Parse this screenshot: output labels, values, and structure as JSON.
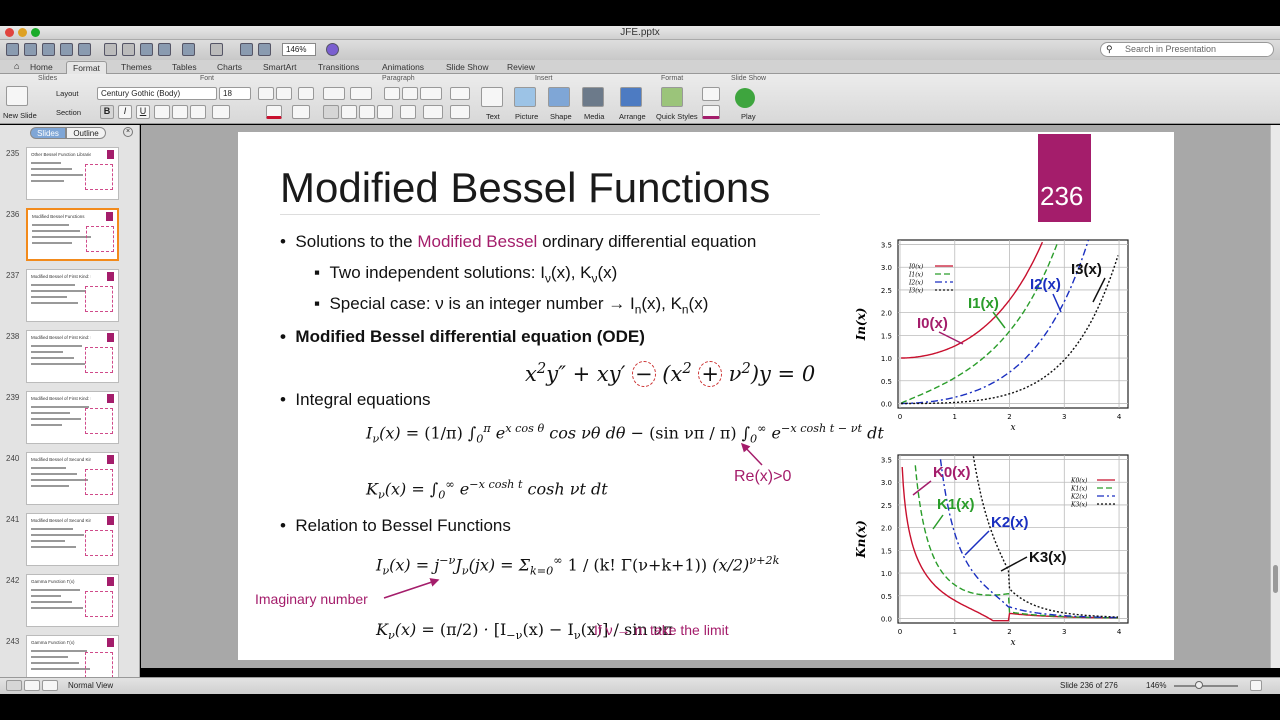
{
  "window": {
    "title": "JFE.pptx"
  },
  "toolbar": {
    "zoom": "146%",
    "search_placeholder": "Search in Presentation"
  },
  "ribbon_tabs": [
    "Home",
    "Format",
    "Themes",
    "Tables",
    "Charts",
    "SmartArt",
    "Transitions",
    "Animations",
    "Slide Show",
    "Review"
  ],
  "ribbon": {
    "groups": {
      "slides": "Slides",
      "font": "Font",
      "paragraph": "Paragraph",
      "insert": "Insert",
      "format": "Format",
      "slideshow": "Slide Show"
    },
    "new_slide": "New Slide",
    "layout": "Layout",
    "section": "Section",
    "font_name": "Century Gothic (Body)",
    "font_size": "18",
    "insert_items": [
      "Text",
      "Picture",
      "Shape",
      "Media"
    ],
    "format_items": [
      "Arrange",
      "Quick Styles"
    ],
    "play": "Play"
  },
  "sidebar": {
    "tabs": [
      "Slides",
      "Outline"
    ],
    "thumbs": [
      {
        "num": "235",
        "title": "Other Bessel Function Libraries"
      },
      {
        "num": "236",
        "title": "Modified Bessel Functions"
      },
      {
        "num": "237",
        "title": "Modified Bessel of First Kind: I_n(x)"
      },
      {
        "num": "238",
        "title": "Modified Bessel of First Kind: I_n(x)"
      },
      {
        "num": "239",
        "title": "Modified Bessel of First Kind: I_n(x)"
      },
      {
        "num": "240",
        "title": "Modified Bessel of Second Kind"
      },
      {
        "num": "241",
        "title": "Modified Bessel of Second Kind"
      },
      {
        "num": "242",
        "title": "Gamma Function Γ(x)"
      },
      {
        "num": "243",
        "title": "Gamma Function Γ(x)"
      }
    ]
  },
  "slide": {
    "title": "Modified Bessel Functions",
    "number": "236",
    "b1_pre": "Solutions to the ",
    "b1_mag": "Modified Bessel",
    "b1_post": " ordinary differential equation",
    "b2": "Modified Bessel differential equation (ODE)",
    "b3": "Integral equations",
    "b4": "Relation to Bessel Functions",
    "re_note": "Re(x)>0",
    "imag_note": "Imaginary number",
    "limit_note": "If ν → n: take the limit"
  },
  "charts": {
    "top": {
      "ylabel": "In(x)",
      "xlabel": "x",
      "yticks": [
        "3.5",
        "3.0",
        "2.5",
        "2.0",
        "1.5",
        "1.0",
        "0.5",
        "0.0"
      ],
      "xticks": [
        "0",
        "1",
        "2",
        "3",
        "4"
      ],
      "legend": [
        "I0(x)",
        "I1(x)",
        "I2(x)",
        "I3(x)"
      ]
    },
    "bottom": {
      "ylabel": "Kn(x)",
      "xlabel": "x",
      "yticks": [
        "3.5",
        "3.0",
        "2.5",
        "2.0",
        "1.5",
        "1.0",
        "0.5",
        "0.0"
      ],
      "xticks": [
        "0",
        "1",
        "2",
        "3",
        "4"
      ],
      "legend": [
        "K0(x)",
        "K1(x)",
        "K2(x)",
        "K3(x)"
      ]
    }
  },
  "colors": {
    "magenta": "#a41d6b",
    "red": "#c8102e",
    "green": "#2a9d2a",
    "blue": "#1a2fc0",
    "black": "#111111"
  },
  "status": {
    "view": "Normal View",
    "slide": "Slide 236 of 276",
    "zoom": "146%"
  }
}
